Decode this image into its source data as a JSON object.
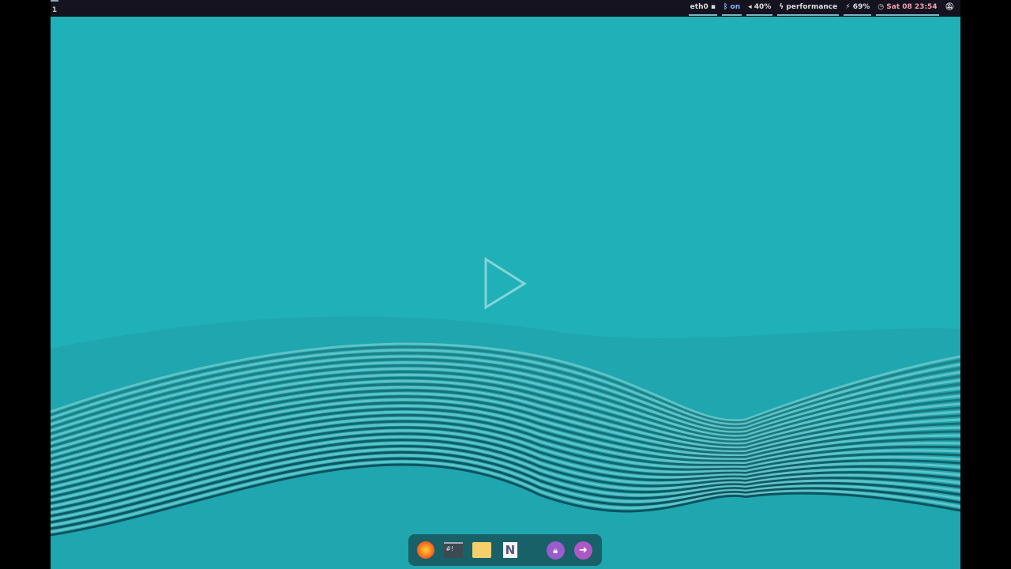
{
  "workspace": {
    "label": "1"
  },
  "status": {
    "network": "eth0",
    "bluetooth": "on",
    "volume": "40%",
    "power_profile": "performance",
    "battery": "69%",
    "datetime": "Sat 08 23:54"
  },
  "dock": {
    "items": [
      "firefox-icon",
      "terminal-icon",
      "files-icon",
      "notes-icon",
      "lock-icon",
      "logout-icon"
    ]
  },
  "colors": {
    "desktop": "#20b0b8",
    "topbar": "#15131f",
    "clock": "#f0a0b0",
    "bluetooth": "#8fb0ff",
    "dock_purple": "#a15ac8"
  }
}
